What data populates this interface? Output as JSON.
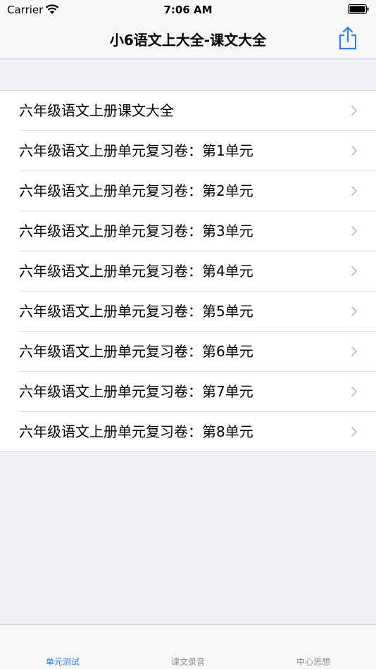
{
  "status_bar": {
    "carrier": "Carrier",
    "time": "7:06 AM"
  },
  "nav": {
    "title": "小6语文上大全-课文大全",
    "share_icon": "share-icon",
    "accent_color": "#2e7cf6"
  },
  "list": {
    "items": [
      {
        "label": "六年级语文上册课文大全"
      },
      {
        "label": "六年级语文上册单元复习卷：第1单元"
      },
      {
        "label": "六年级语文上册单元复习卷：第2单元"
      },
      {
        "label": "六年级语文上册单元复习卷：第3单元"
      },
      {
        "label": "六年级语文上册单元复习卷：第4单元"
      },
      {
        "label": "六年级语文上册单元复习卷：第5单元"
      },
      {
        "label": "六年级语文上册单元复习卷：第6单元"
      },
      {
        "label": "六年级语文上册单元复习卷：第7单元"
      },
      {
        "label": "六年级语文上册单元复习卷：第8单元"
      }
    ]
  },
  "tab_bar": {
    "tabs": [
      {
        "label": "单元测试",
        "active": true
      },
      {
        "label": "课文录音",
        "active": false
      },
      {
        "label": "中心思想",
        "active": false
      }
    ]
  }
}
